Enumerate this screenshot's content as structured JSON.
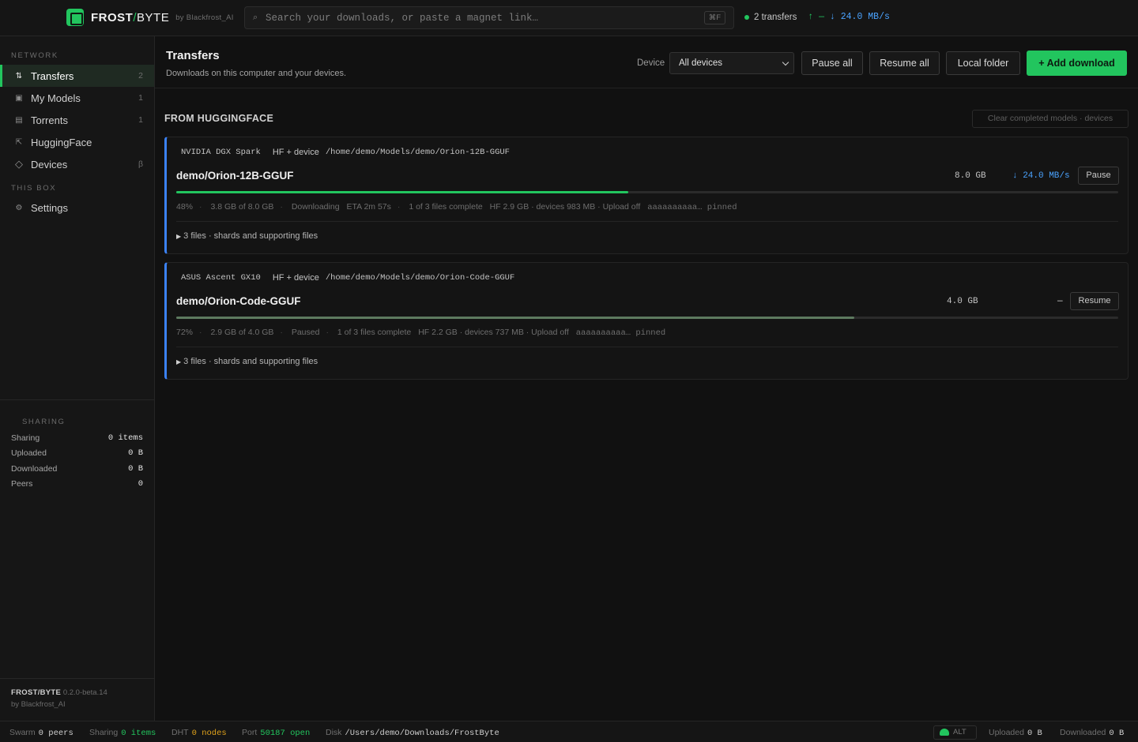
{
  "brand": {
    "name_left": "FROST",
    "slash": "/",
    "name_right": "BYTE",
    "by": "by Blackfrost_AI"
  },
  "search": {
    "placeholder": "Search your downloads, or paste a magnet link…",
    "shortcut": "⌘F"
  },
  "top_status": {
    "transfers": "2 transfers",
    "up": "↑ —",
    "down": "↓ 24.0 MB/s"
  },
  "sidebar": {
    "network_label": "NETWORK",
    "items": [
      {
        "label": "Transfers",
        "count": "2",
        "icon": "transfers-icon"
      },
      {
        "label": "My Models",
        "count": "1",
        "icon": "models-icon"
      },
      {
        "label": "Torrents",
        "count": "1",
        "icon": "torrents-icon"
      },
      {
        "label": "HuggingFace",
        "count": "",
        "icon": "huggingface-icon"
      },
      {
        "label": "Devices",
        "count": "β",
        "icon": "devices-icon"
      }
    ],
    "thisbox_label": "THIS BOX",
    "settings_label": "Settings",
    "sharing_label": "SHARING",
    "stats": [
      {
        "label": "Sharing",
        "value": "0 items"
      },
      {
        "label": "Uploaded",
        "value": "0 B"
      },
      {
        "label": "Downloaded",
        "value": "0 B"
      },
      {
        "label": "Peers",
        "value": "0"
      }
    ],
    "version_name": "FROST/BYTE",
    "version": "0.2.0-beta.14",
    "version_by": "by Blackfrost_AI"
  },
  "header": {
    "title": "Transfers",
    "subtitle": "Downloads on this computer and your devices.",
    "device_label": "Device",
    "device_value": "All devices",
    "pause_all": "Pause all",
    "resume_all": "Resume all",
    "local_folder": "Local folder",
    "add_download": "+ Add download"
  },
  "section": {
    "title": "FROM HUGGINGFACE",
    "clear": "Clear completed models · devices"
  },
  "transfers": [
    {
      "device": "NVIDIA DGX Spark",
      "source": "HF + device",
      "path": "/home/demo/Models/demo/Orion-12B-GGUF",
      "name": "demo/Orion-12B-GGUF",
      "size": "8.0 GB",
      "rate": "↓ 24.0 MB/s",
      "action": "Pause",
      "progress": 0.48,
      "pct": "48%",
      "amount": "3.8 GB of 8.0 GB",
      "state": "Downloading",
      "eta": "ETA 2m 57s",
      "files_complete": "1 of 3 files complete",
      "breakdown": "HF 2.9 GB · devices 983 MB · Upload off",
      "hash": "aaaaaaaaaa… pinned",
      "files": "3 files · shards and supporting files",
      "colors": {
        "fill": "#22c55e",
        "rate": "#4aa3ff"
      }
    },
    {
      "device": "ASUS Ascent GX10",
      "source": "HF + device",
      "path": "/home/demo/Models/demo/Orion-Code-GGUF",
      "name": "demo/Orion-Code-GGUF",
      "size": "4.0 GB",
      "rate": "—",
      "action": "Resume",
      "progress": 0.72,
      "pct": "72%",
      "amount": "2.9 GB of 4.0 GB",
      "state": "Paused",
      "eta": "",
      "files_complete": "1 of 3 files complete",
      "breakdown": "HF 2.2 GB · devices 737 MB · Upload off",
      "hash": "aaaaaaaaaa… pinned",
      "files": "3 files · shards and supporting files",
      "colors": {
        "fill": "#5d7a5f",
        "rate": "#d8d8d8"
      }
    }
  ],
  "statusbar": {
    "swarm_label": "Swarm",
    "swarm_value": "0 peers",
    "sharing_label": "Sharing",
    "sharing_value": "0 items",
    "dht_label": "DHT",
    "dht_value": "0 nodes",
    "port_label": "Port",
    "port_value": "50187 open",
    "disk_label": "Disk",
    "disk_value": "/Users/demo/Downloads/FrostByte",
    "alt": "ALT",
    "uploaded_label": "Uploaded",
    "uploaded_value": "0 B",
    "downloaded_label": "Downloaded",
    "downloaded_value": "0 B"
  }
}
